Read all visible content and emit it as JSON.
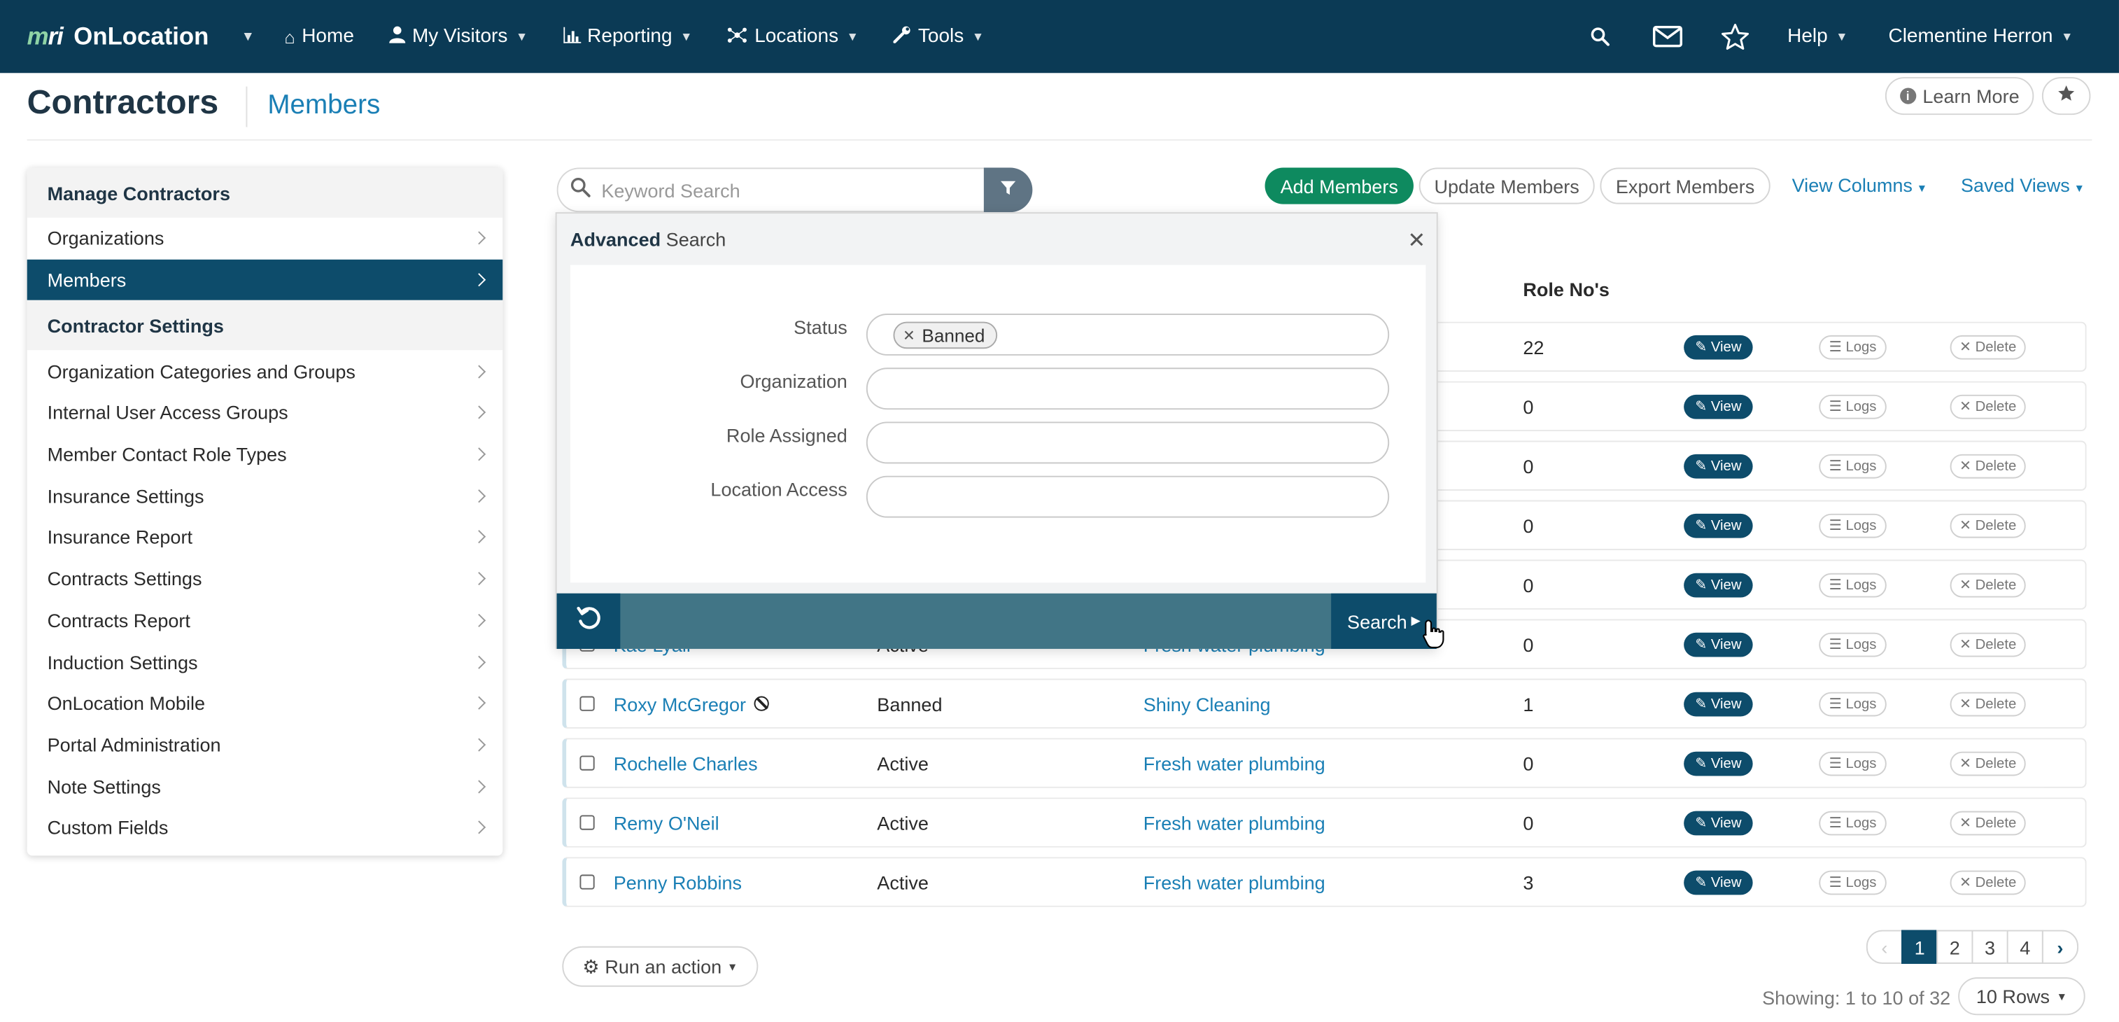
{
  "navbar": {
    "brand_logo_a": "m",
    "brand_logo_b": "ri",
    "brand_name": "OnLocation",
    "items": [
      {
        "label": "Home",
        "icon": "home-icon"
      },
      {
        "label": "My Visitors",
        "icon": "user-icon"
      },
      {
        "label": "Reporting",
        "icon": "bar-chart-icon"
      },
      {
        "label": "Locations",
        "icon": "network-icon"
      },
      {
        "label": "Tools",
        "icon": "wrench-icon"
      }
    ],
    "help": "Help",
    "user": "Clementine Herron"
  },
  "header": {
    "title": "Contractors",
    "subtitle": "Members",
    "learn_more": "Learn More"
  },
  "sidebar": {
    "section1": "Manage Contractors",
    "items1": [
      "Organizations",
      "Members"
    ],
    "section2": "Contractor Settings",
    "items2": [
      "Organization Categories and Groups",
      "Internal User Access Groups",
      "Member Contact Role Types",
      "Insurance Settings",
      "Insurance Report",
      "Contracts Settings",
      "Contracts Report",
      "Induction Settings",
      "OnLocation Mobile",
      "Portal Administration",
      "Note Settings",
      "Custom Fields"
    ]
  },
  "search": {
    "placeholder": "Keyword Search"
  },
  "actions": {
    "add": "Add Members",
    "update": "Update Members",
    "export": "Export Members",
    "view_columns": "View Columns",
    "saved_views": "Saved Views"
  },
  "table": {
    "role_header": "Role No's",
    "view_label": "View",
    "logs_label": "Logs",
    "delete_label": "Delete",
    "hidden_rows": [
      {
        "roles": "22"
      },
      {
        "roles": "0"
      },
      {
        "roles": "0"
      },
      {
        "roles": "0"
      },
      {
        "roles": "0"
      }
    ],
    "partial_row": {
      "name": "Kae Lyall",
      "status": "Active",
      "org": "Fresh water plumbing",
      "roles": "0"
    },
    "rows": [
      {
        "name": "Roxy McGregor",
        "status": "Banned",
        "org": "Shiny Cleaning",
        "roles": "1"
      },
      {
        "name": "Rochelle Charles",
        "status": "Active",
        "org": "Fresh water plumbing",
        "roles": "0"
      },
      {
        "name": "Remy O'Neil",
        "status": "Active",
        "org": "Fresh water plumbing",
        "roles": "0"
      },
      {
        "name": "Penny Robbins",
        "status": "Active",
        "org": "Fresh water plumbing",
        "roles": "3"
      }
    ]
  },
  "footer": {
    "run_action": "Run an action",
    "pages": [
      "1",
      "2",
      "3",
      "4"
    ],
    "showing": "Showing: 1 to 10 of 32",
    "rows_select": "10 Rows"
  },
  "advanced": {
    "title_bold": "Advanced",
    "title_rest": " Search",
    "labels": [
      "Status",
      "Organization",
      "Role Assigned",
      "Location Access"
    ],
    "status_tag": "Banned",
    "search_button": "Search"
  }
}
